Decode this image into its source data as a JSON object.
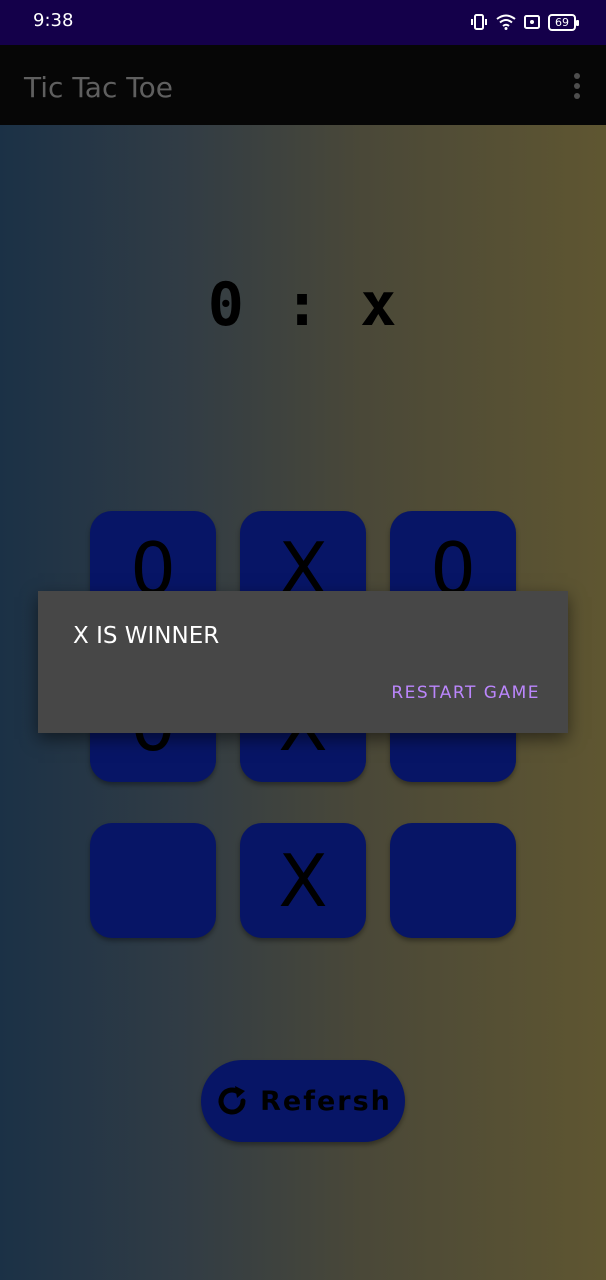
{
  "status_bar": {
    "time": "9:38",
    "battery_level": "69",
    "icons": [
      "vibrate-icon",
      "wifi-icon",
      "screen-record-icon",
      "battery-icon"
    ]
  },
  "app_bar": {
    "title": "Tic Tac Toe",
    "menu_icon": "more-vert-icon"
  },
  "score": {
    "player_o": "0",
    "separator": ":",
    "player_x": "x"
  },
  "board": {
    "cells": [
      "0",
      "X",
      "0",
      "0",
      "X",
      "",
      "",
      "X",
      ""
    ]
  },
  "refresh_button": {
    "icon": "refresh-icon",
    "label": "Refersh"
  },
  "dialog": {
    "message": "X IS WINNER",
    "action_label": "RESTART GAME"
  },
  "colors": {
    "status_bar_bg": "#14004a",
    "app_bar_bg": "#060606",
    "cell_bg": "#071566",
    "dialog_bg": "#474747",
    "dialog_action": "#bb86fc"
  }
}
